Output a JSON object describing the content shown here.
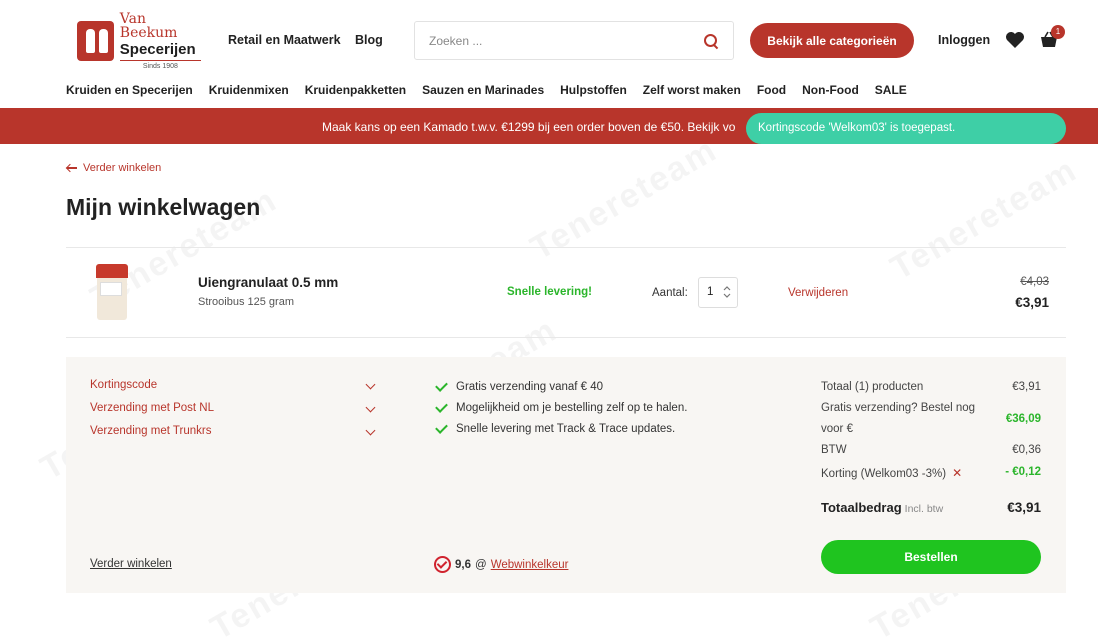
{
  "header": {
    "logo": {
      "line1": "Van Beekum",
      "line2": "Specerijen",
      "line3": "Sinds 1908"
    },
    "links": [
      "Retail en Maatwerk",
      "Blog"
    ],
    "search_placeholder": "Zoeken ...",
    "categories_button": "Bekijk alle categorieën",
    "login": "Inloggen",
    "cart_count": "1",
    "icons": {
      "search": "search-icon",
      "wishlist": "heart-icon",
      "cart": "basket-icon"
    }
  },
  "nav": [
    "Kruiden en Specerijen",
    "Kruidenmixen",
    "Kruidenpakketten",
    "Sauzen en Marinades",
    "Hulpstoffen",
    "Zelf worst maken",
    "Food",
    "Non-Food",
    "SALE"
  ],
  "promo": {
    "text": "Maak kans op een Kamado t.w.v. €1299 bij een order boven de €50. Bekijk vo"
  },
  "toast": {
    "text": "Kortingscode 'Welkom03' is toegepast."
  },
  "page": {
    "back_link": "Verder winkelen",
    "title": "Mijn winkelwagen"
  },
  "cart_item": {
    "name": "Uiengranulaat 0.5 mm",
    "variant": "Strooibus 125 gram",
    "delivery": "Snelle levering!",
    "qty_label": "Aantal:",
    "qty": "1",
    "remove": "Verwijderen",
    "old_price": "€4,03",
    "price": "€3,91"
  },
  "summary": {
    "accordions": [
      "Kortingscode",
      "Verzending met Post NL",
      "Verzending met Trunkrs"
    ],
    "features": [
      "Gratis verzending vanaf € 40",
      "Mogelijkheid om je bestelling zelf op te halen.",
      "Snelle levering met Track & Trace updates."
    ],
    "lines": {
      "subtotal_label": "Totaal (1) producten",
      "subtotal": "€3,91",
      "free_shipping_label_1": "Gratis verzending? Bestel nog",
      "free_shipping_label_2": "voor €",
      "free_shipping_amount": "€36,09",
      "vat_label": "BTW",
      "vat": "€0,36",
      "discount_label": "Korting (Welkom03 -3%)",
      "discount_remove": "✕",
      "discount": "- €0,12"
    },
    "total_label": "Totaalbedrag",
    "total_note": "Incl. btw",
    "total": "€3,91",
    "order_button": "Bestellen",
    "continue_link": "Verder winkelen",
    "rating_score": "9,6",
    "rating_at": "@",
    "rating_source": "Webwinkelkeur"
  },
  "colors": {
    "brand": "#b8352b",
    "success": "#1fc41f",
    "toast": "#3ecfa6",
    "panel": "#f8f6f3"
  },
  "watermark": "Tenereteam"
}
